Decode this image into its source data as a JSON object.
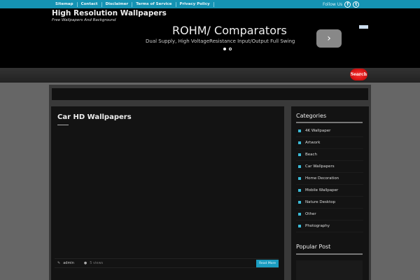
{
  "topbar": {
    "links": [
      "Sitemap",
      "Contact",
      "Disclaimer",
      "Terms of Service",
      "Privacy Policy"
    ],
    "follow_label": "Follow Us",
    "social": [
      "facebook-icon",
      "twitter-icon"
    ],
    "accent": "#1593b3"
  },
  "header": {
    "title": "High Resolution Wallpapers",
    "tagline": "Free Wallpapers And Background"
  },
  "ad": {
    "title": "ROHM/ Comparators",
    "subtitle": "Dual Supply, High VoltageResistance Input/Output Full Swing",
    "next": "›"
  },
  "nav": {
    "search_label": "Search"
  },
  "post": {
    "title": "Car HD Wallpapers",
    "author": "admin",
    "views": "5 views",
    "read_more": "Read More"
  },
  "sidebar": {
    "categories_title": "Categories",
    "categories": [
      "4K Wallpaper",
      "Artwork",
      "Beach",
      "Car Wallpapers",
      "Home Decoration",
      "Mobile Wallpaper",
      "Nature Desktop",
      "Other",
      "Photography"
    ],
    "popular_title": "Popular Post"
  }
}
